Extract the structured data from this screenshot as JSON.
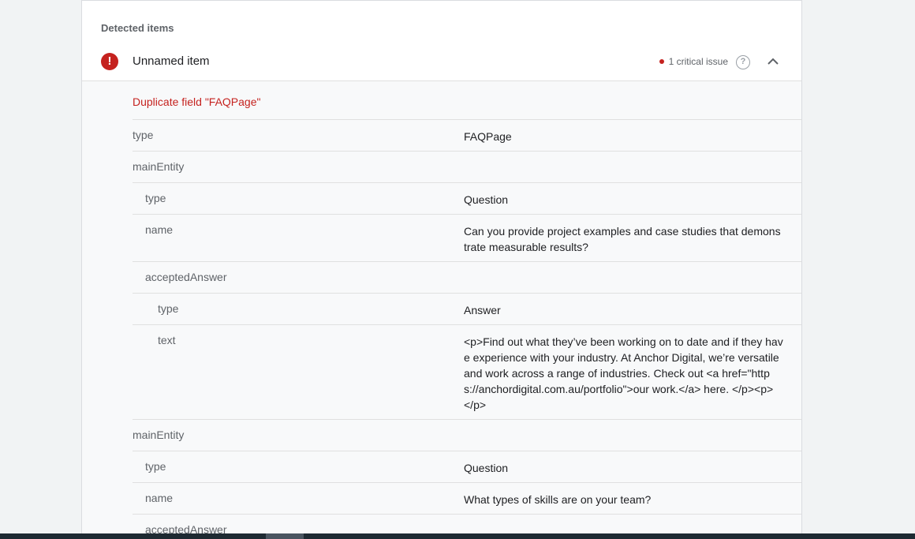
{
  "section": {
    "label": "Detected items"
  },
  "item": {
    "title": "Unnamed item",
    "status_icon": "error-icon",
    "issue_text": "1 critical issue",
    "help_icon": "help-icon",
    "collapse_icon": "chevron-up-icon"
  },
  "error_message": "Duplicate field \"FAQPage\"",
  "rows": [
    {
      "key": "type",
      "value": "FAQPage"
    },
    {
      "key": "mainEntity",
      "value": ""
    },
    {
      "key": "type",
      "value": "Question"
    },
    {
      "key": "name",
      "value": "Can you provide project examples and case studies that demonstrate measurable results?"
    },
    {
      "key": "acceptedAnswer",
      "value": ""
    },
    {
      "key": "type",
      "value": "Answer"
    },
    {
      "key": "text",
      "value": "<p>Find out what they’ve been working on to date and if they have experience with your industry. At Anchor Digital, we’re versatile and work across a range of industries. Check out <a href=\"https://anchordigital.com.au/portfolio\">our work.</a> here. </p><p> </p>"
    },
    {
      "key": "mainEntity",
      "value": ""
    },
    {
      "key": "type",
      "value": "Question"
    },
    {
      "key": "name",
      "value": "What types of skills are on your team?"
    },
    {
      "key": "acceptedAnswer",
      "value": ""
    }
  ],
  "colors": {
    "error": "#c5221f",
    "label": "#5f6368",
    "text": "#202124"
  }
}
